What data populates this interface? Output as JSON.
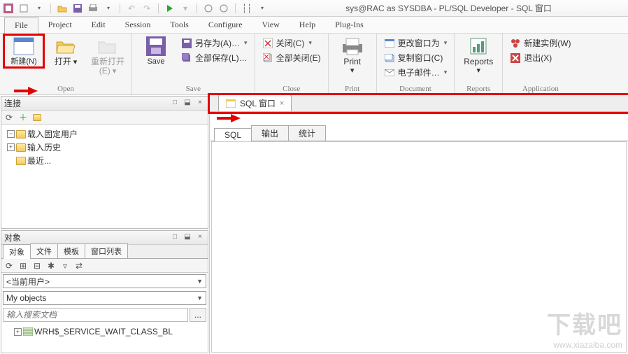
{
  "title": "sys@RAC as SYSDBA - PL/SQL Developer - SQL 窗口",
  "menu": {
    "file": "File",
    "project": "Project",
    "edit": "Edit",
    "session": "Session",
    "tools": "Tools",
    "configure": "Configure",
    "view": "View",
    "help": "Help",
    "plugins": "Plug-Ins"
  },
  "ribbon": {
    "open_group": "Open",
    "new": "新建(N)",
    "open": "打开",
    "reopen": "重新打开(E)",
    "save_group": "Save",
    "save": "Save",
    "save_as": "另存为(A)…",
    "save_all": "全部保存(L)…",
    "close_group": "Close",
    "close": "关闭(C)",
    "close_all": "全部关闭(E)",
    "print_group": "Print",
    "print": "Print",
    "doc_group": "Document",
    "change_win": "更改窗口为",
    "copy_win": "复制窗口(C)",
    "email": "电子邮件…",
    "reports_group": "Reports",
    "reports": "Reports",
    "app_group": "Application",
    "new_inst": "新建实例(W)",
    "exit": "退出(X)"
  },
  "panels": {
    "conn": "连接",
    "tree": {
      "root_load": "载入固定用户",
      "root_hist": "输入历史",
      "root_recent": "最近..."
    },
    "objects": "对象",
    "obj_tabs": {
      "obj": "对象",
      "file": "文件",
      "tpl": "模板",
      "winlist": "窗口列表"
    },
    "current_user": "<当前用户>",
    "my_objects": "My objects",
    "search_ph": "输入搜索文档",
    "search_btn": "...",
    "obj_item1": "WRH$_SERVICE_WAIT_CLASS_BL"
  },
  "doc": {
    "tab": "SQL 窗口",
    "sub_sql": "SQL",
    "sub_out": "输出",
    "sub_stat": "统计"
  },
  "watermark": {
    "big": "下载吧",
    "small": "www.xiazaiba.com"
  }
}
